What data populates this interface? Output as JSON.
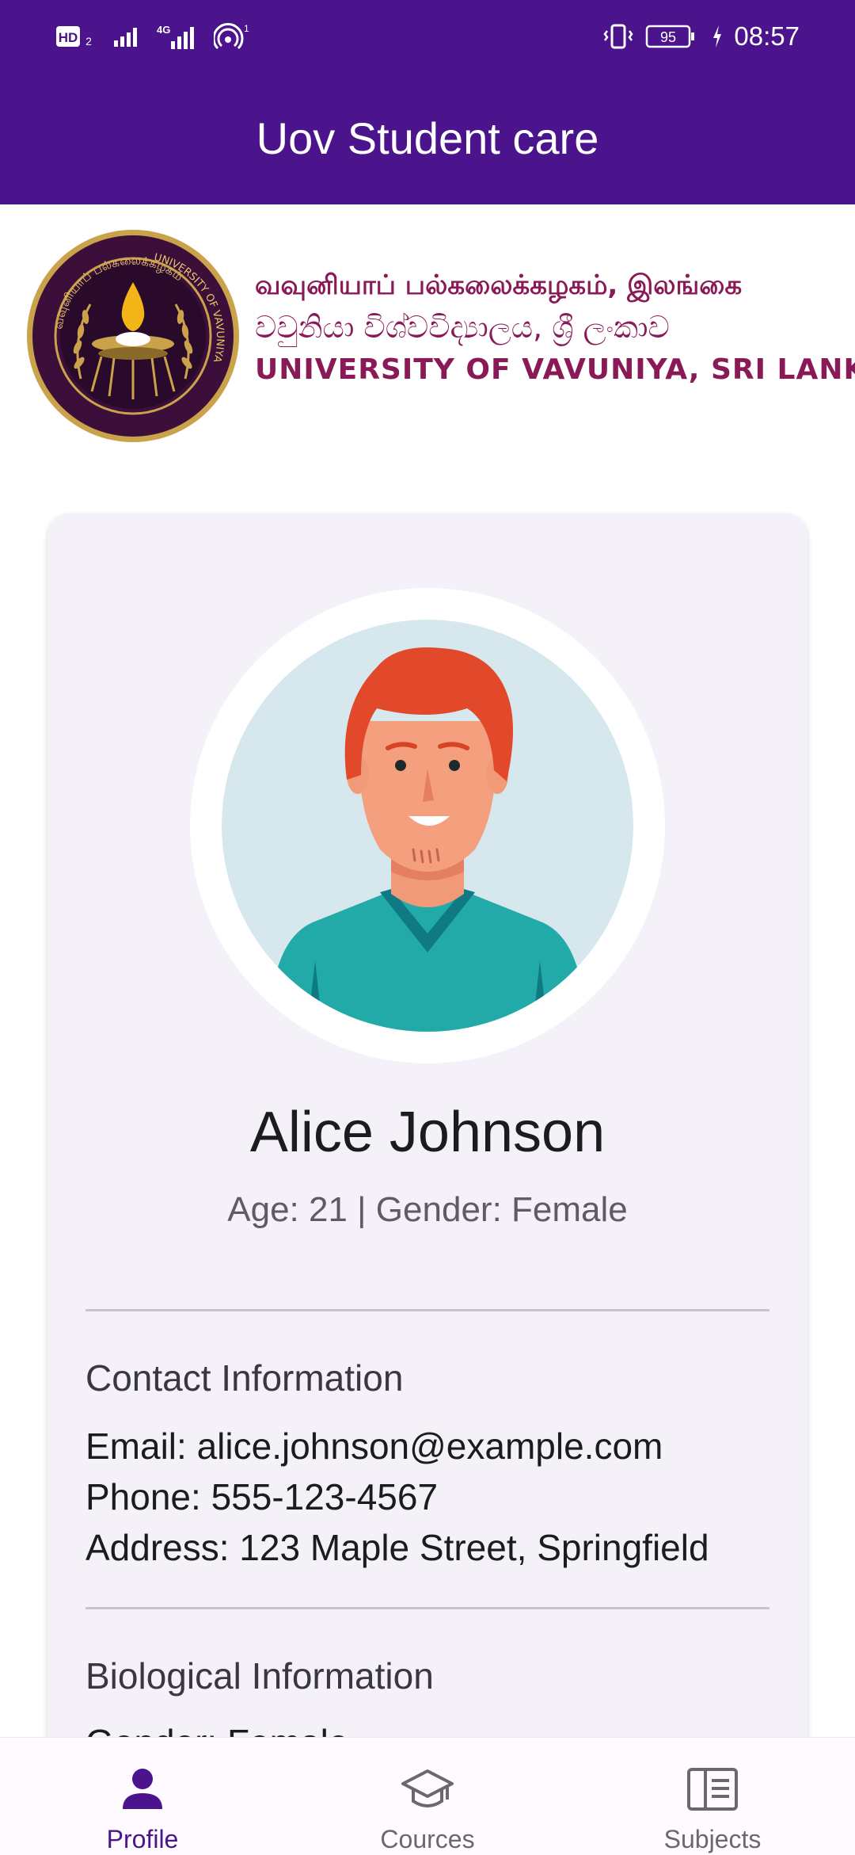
{
  "status_bar": {
    "time": "08:57",
    "battery": "95",
    "network": "4G",
    "hd_label": "HD",
    "sim_index": "2",
    "hotspot_count": "1"
  },
  "app_bar": {
    "title": "Uov Student care"
  },
  "banner": {
    "line_tamil": "வவுனியாப் பல்கலைக்கழகம், இலங்கை",
    "line_sinhala": "වවුනියා විශ්වවිද්‍යාලය, ශ්‍රී ලංකාව",
    "line_english": "UNIVERSITY OF VAVUNIYA, SRI LANKA",
    "seal_text_top": "வவுனியாப் பல்கலைக்கழகம்",
    "seal_text_right": "UNIVERSITY OF VAVUNIYA"
  },
  "profile": {
    "name": "Alice Johnson",
    "summary": "Age: 21 | Gender: Female",
    "contact": {
      "title": "Contact Information",
      "email": "Email: alice.johnson@example.com",
      "phone": "Phone: 555-123-4567",
      "address": "Address: 123 Maple Street, Springfield"
    },
    "biological": {
      "title": "Biological Information",
      "gender": "Gender: Female"
    }
  },
  "bottom_nav": {
    "items": [
      {
        "label": "Profile",
        "icon": "person-icon",
        "active": true
      },
      {
        "label": "Cources",
        "icon": "graduation-cap-icon",
        "active": false
      },
      {
        "label": "Subjects",
        "icon": "book-icon",
        "active": false
      }
    ]
  },
  "colors": {
    "primary": "#4b148d",
    "card_bg": "#f5f1f8",
    "banner_text": "#8a1a57",
    "nav_active": "#4b148d",
    "nav_inactive": "#6b6770"
  }
}
